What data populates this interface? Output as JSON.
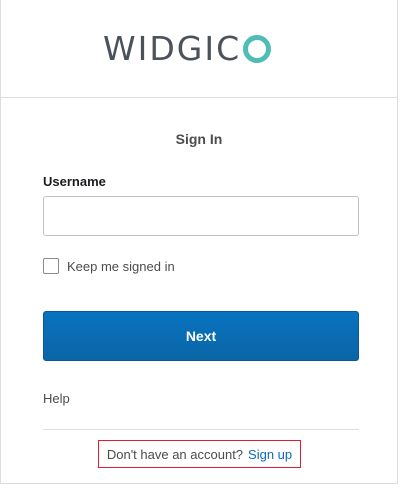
{
  "header": {
    "logo_text": "WIDGIC",
    "logo_name": "WIDGICO",
    "logo_circle_color": "#4fbcb5"
  },
  "form": {
    "title": "Sign In",
    "username_label": "Username",
    "username_value": "",
    "keep_signed_in_label": "Keep me signed in",
    "keep_signed_in_checked": false,
    "submit_label": "Next",
    "help_label": "Help"
  },
  "footer": {
    "no_account_text": "Don't have an account?",
    "signup_label": "Sign up"
  },
  "colors": {
    "primary_button": "#0873bf",
    "link": "#0a6bb5",
    "highlight_border": "#e01e2d"
  }
}
